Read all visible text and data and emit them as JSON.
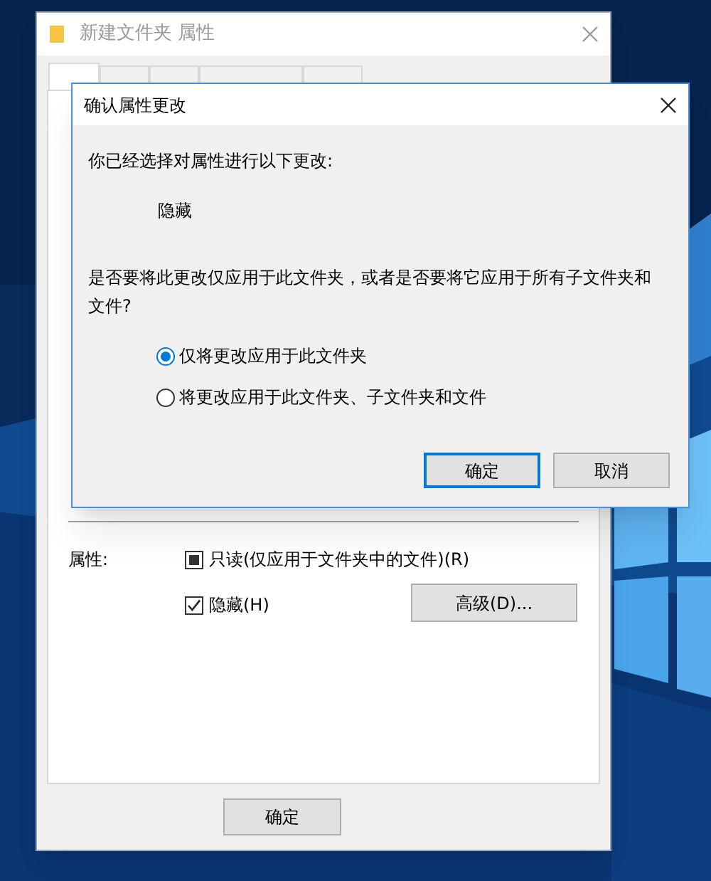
{
  "back_window": {
    "title": "新建文件夹 属性",
    "tabs": [
      {
        "selected": true
      },
      {
        "selected": false
      },
      {
        "selected": false
      },
      {
        "selected": false
      },
      {
        "selected": false
      }
    ],
    "attributes_label": "属性:",
    "attributes": [
      {
        "label": "只读(仅应用于文件夹中的文件)(R)",
        "checked": false,
        "indeterminate": true
      },
      {
        "label": "隐藏(H)",
        "checked": true,
        "indeterminate": false
      }
    ],
    "advanced_button": "高级(D)...",
    "buttons": [
      "确定"
    ]
  },
  "dialog": {
    "title": "确认属性更改",
    "intro": "你已经选择对属性进行以下更改:",
    "changes": [
      "隐藏"
    ],
    "question": "是否要将此更改仅应用于此文件夹，或者是否要将它应用于所有子文件夹和文件?",
    "options": [
      {
        "label": "仅将更改应用于此文件夹",
        "selected": true
      },
      {
        "label": "将更改应用于此文件夹、子文件夹和文件",
        "selected": false
      }
    ],
    "buttons": [
      {
        "label": "确定",
        "default": true
      },
      {
        "label": "取消",
        "default": false
      }
    ]
  }
}
